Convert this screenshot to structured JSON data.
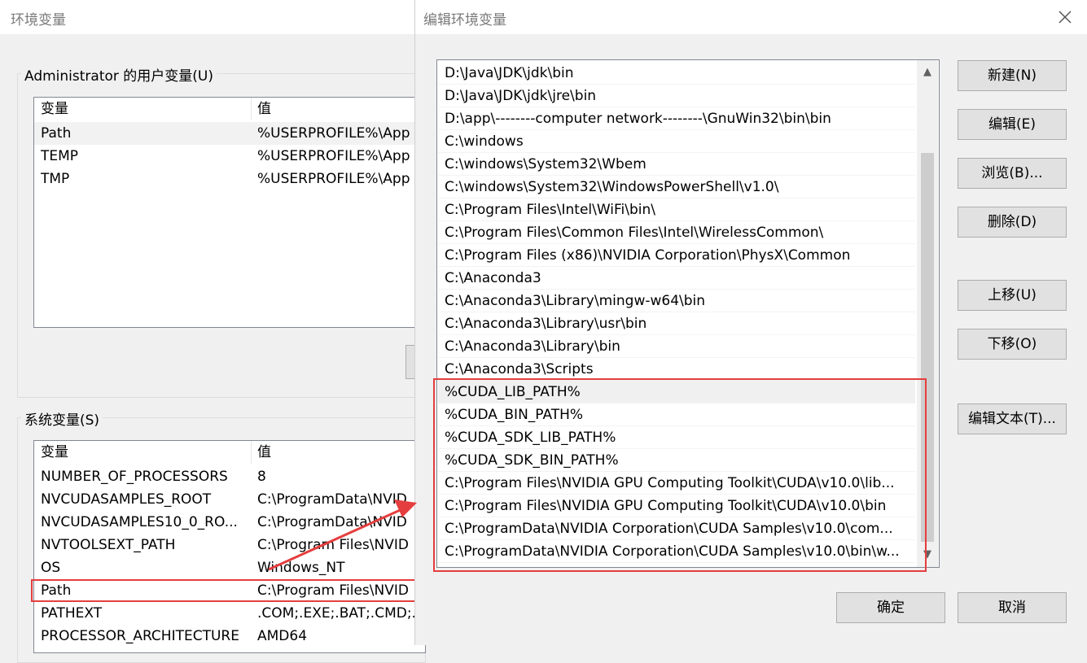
{
  "background_dialog": {
    "title": "环境变量",
    "user_vars": {
      "group_label": "Administrator 的用户变量(U)",
      "header": {
        "name": "变量",
        "value": "值"
      },
      "rows": [
        {
          "name": "Path",
          "value": "%USERPROFILE%\\App"
        },
        {
          "name": "TEMP",
          "value": "%USERPROFILE%\\App"
        },
        {
          "name": "TMP",
          "value": "%USERPROFILE%\\App"
        }
      ]
    },
    "system_vars": {
      "group_label": "系统变量(S)",
      "header": {
        "name": "变量",
        "value": "值"
      },
      "rows": [
        {
          "name": "NUMBER_OF_PROCESSORS",
          "value": "8"
        },
        {
          "name": "NVCUDASAMPLES_ROOT",
          "value": "C:\\ProgramData\\NVID"
        },
        {
          "name": "NVCUDASAMPLES10_0_RO...",
          "value": "C:\\ProgramData\\NVID"
        },
        {
          "name": "NVTOOLSEXT_PATH",
          "value": "C:\\Program Files\\NVID"
        },
        {
          "name": "OS",
          "value": "Windows_NT"
        },
        {
          "name": "Path",
          "value": "C:\\Program Files\\NVID"
        },
        {
          "name": "PATHEXT",
          "value": ".COM;.EXE;.BAT;.CMD;.V"
        },
        {
          "name": "PROCESSOR_ARCHITECTURE",
          "value": "AMD64"
        }
      ]
    }
  },
  "edit_dialog": {
    "title": "编辑环境变量",
    "path_entries": [
      "D:\\Java\\JDK\\jdk\\bin",
      "D:\\Java\\JDK\\jdk\\jre\\bin",
      "D:\\app\\--------computer network--------\\GnuWin32\\bin\\bin",
      "C:\\windows",
      "C:\\windows\\System32\\Wbem",
      "C:\\windows\\System32\\WindowsPowerShell\\v1.0\\",
      "C:\\Program Files\\Intel\\WiFi\\bin\\",
      "C:\\Program Files\\Common Files\\Intel\\WirelessCommon\\",
      "C:\\Program Files (x86)\\NVIDIA Corporation\\PhysX\\Common",
      "C:\\Anaconda3",
      "C:\\Anaconda3\\Library\\mingw-w64\\bin",
      "C:\\Anaconda3\\Library\\usr\\bin",
      "C:\\Anaconda3\\Library\\bin",
      "C:\\Anaconda3\\Scripts",
      "%CUDA_LIB_PATH%",
      "%CUDA_BIN_PATH%",
      "%CUDA_SDK_LIB_PATH%",
      "%CUDA_SDK_BIN_PATH%",
      "C:\\Program Files\\NVIDIA GPU Computing Toolkit\\CUDA\\v10.0\\lib...",
      "C:\\Program Files\\NVIDIA GPU Computing Toolkit\\CUDA\\v10.0\\bin",
      "C:\\ProgramData\\NVIDIA Corporation\\CUDA Samples\\v10.0\\com...",
      "C:\\ProgramData\\NVIDIA Corporation\\CUDA Samples\\v10.0\\bin\\w..."
    ],
    "buttons": {
      "new": "新建(N)",
      "edit": "编辑(E)",
      "browse": "浏览(B)...",
      "delete": "删除(D)",
      "move_up": "上移(U)",
      "move_down": "下移(O)",
      "edit_text": "编辑文本(T)...",
      "ok": "确定",
      "cancel": "取消"
    }
  },
  "colors": {
    "highlight": "#e53e3e",
    "dialog_bg": "#f0f0f0",
    "button_bg": "#e1e1e1"
  },
  "icons": [
    "close-icon",
    "scroll-up-icon",
    "scroll-down-icon"
  ]
}
